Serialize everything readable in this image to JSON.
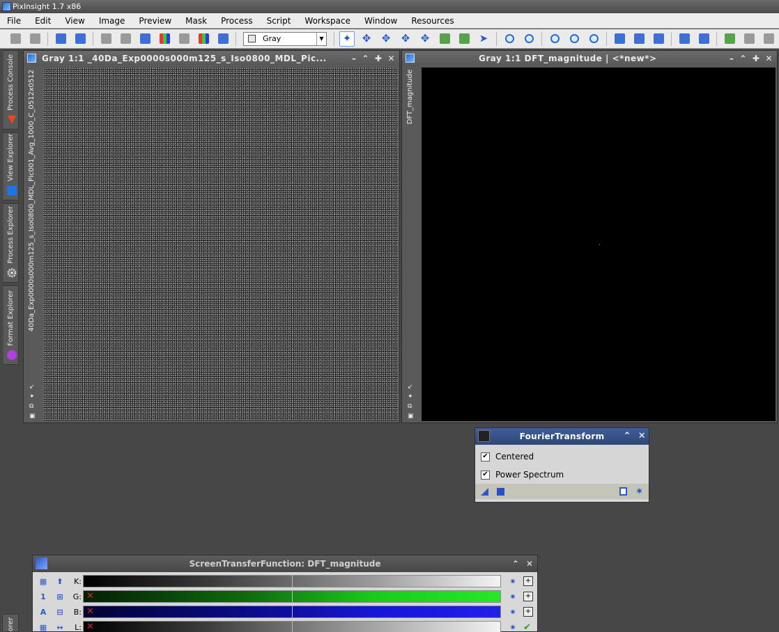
{
  "app": {
    "title": "PixInsight 1.7 x86"
  },
  "menu": [
    "File",
    "Edit",
    "View",
    "Image",
    "Preview",
    "Mask",
    "Process",
    "Script",
    "Workspace",
    "Window",
    "Resources"
  ],
  "toolbar": {
    "mode_combo": "Gray"
  },
  "sidebar": {
    "tabs": [
      {
        "label": "Process Console",
        "icon": "process-console-icon"
      },
      {
        "label": "View Explorer",
        "icon": "view-explorer-icon"
      },
      {
        "label": "Process Explorer",
        "icon": "gear-icon"
      },
      {
        "label": "Format Explorer",
        "icon": "format-explorer-icon"
      }
    ],
    "bottom_tab": "orer"
  },
  "windows": {
    "left": {
      "title": "Gray 1:1 _40Da_Exp0000s000m125_s_Iso0800_MDL_Pic...",
      "vertical_label": "40Da_Exp0000s000m125_s_Iso0800_MDL_Pic001_Avg_1000_C_0512x0512",
      "controls": [
        "–",
        "⌃",
        "✚",
        "✕"
      ]
    },
    "right": {
      "title": "Gray 1:1 DFT_magnitude | <*new*>",
      "vertical_label": "DFT_magnitude",
      "controls": [
        "–",
        "⌃",
        "✚",
        "✕"
      ]
    }
  },
  "fourier": {
    "title": "FourierTransform",
    "centered_label": "Centered",
    "centered_checked": true,
    "power_label": "Power Spectrum",
    "power_checked": true
  },
  "stf": {
    "title": "ScreenTransferFunction: DFT_magnitude",
    "rows": [
      {
        "channel": "K:"
      },
      {
        "channel": "G:"
      },
      {
        "channel": "B:"
      },
      {
        "channel": "L:"
      }
    ]
  },
  "colors": {
    "workspace": "#474747",
    "dialog_title": "#2e4778",
    "accent_blue": "#2b59c8",
    "green_channel": "#1acc1a",
    "blue_channel": "#1616d6"
  }
}
